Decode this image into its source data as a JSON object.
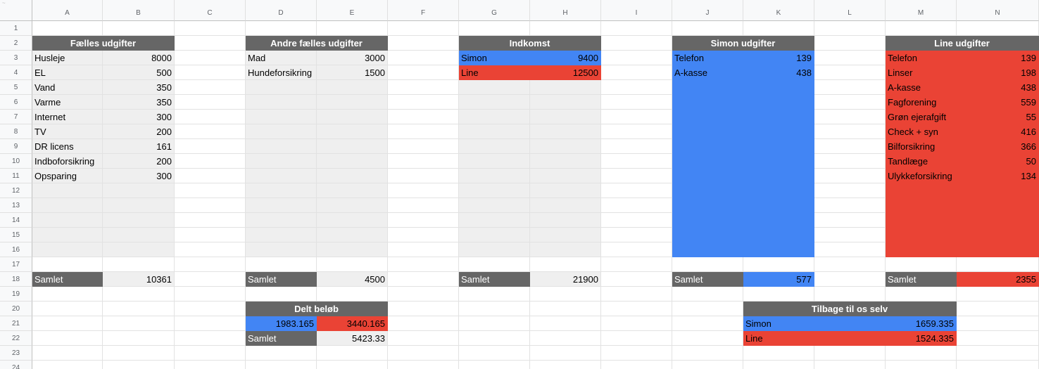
{
  "columns": [
    "A",
    "B",
    "C",
    "D",
    "E",
    "F",
    "G",
    "H",
    "I",
    "J",
    "K",
    "L",
    "M",
    "N"
  ],
  "rows": [
    "1",
    "2",
    "3",
    "4",
    "5",
    "6",
    "7",
    "8",
    "9",
    "10",
    "11",
    "12",
    "13",
    "14",
    "15",
    "16",
    "17",
    "18",
    "19",
    "20",
    "21",
    "22",
    "23",
    "24"
  ],
  "blocks": {
    "faelles": {
      "header": "Fælles udgifter",
      "items": [
        {
          "label": "Husleje",
          "value": "8000"
        },
        {
          "label": "EL",
          "value": "500"
        },
        {
          "label": "Vand",
          "value": "350"
        },
        {
          "label": "Varme",
          "value": "350"
        },
        {
          "label": "Internet",
          "value": "300"
        },
        {
          "label": "TV",
          "value": "200"
        },
        {
          "label": "DR licens",
          "value": "161"
        },
        {
          "label": "Indboforsikring",
          "value": "200"
        },
        {
          "label": "Opsparing",
          "value": "300"
        }
      ],
      "total_label": "Samlet",
      "total": "10361"
    },
    "andre": {
      "header": "Andre fælles udgifter",
      "items": [
        {
          "label": "Mad",
          "value": "3000"
        },
        {
          "label": "Hundeforsikring",
          "value": "1500"
        }
      ],
      "total_label": "Samlet",
      "total": "4500"
    },
    "indkomst": {
      "header": "Indkomst",
      "items": [
        {
          "label": "Simon",
          "value": "9400"
        },
        {
          "label": "Line",
          "value": "12500"
        }
      ],
      "total_label": "Samlet",
      "total": "21900"
    },
    "simon": {
      "header": "Simon udgifter",
      "items": [
        {
          "label": "Telefon",
          "value": "139"
        },
        {
          "label": "A-kasse",
          "value": "438"
        }
      ],
      "total_label": "Samlet",
      "total": "577"
    },
    "line": {
      "header": "Line udgifter",
      "items": [
        {
          "label": "Telefon",
          "value": "139"
        },
        {
          "label": "Linser",
          "value": "198"
        },
        {
          "label": "A-kasse",
          "value": "438"
        },
        {
          "label": "Fagforening",
          "value": "559"
        },
        {
          "label": "Grøn ejerafgift",
          "value": "55"
        },
        {
          "label": "Check + syn",
          "value": "416"
        },
        {
          "label": "Bilforsikring",
          "value": "366"
        },
        {
          "label": "Tandlæge",
          "value": "50"
        },
        {
          "label": "Ulykkeforsikring",
          "value": "134"
        }
      ],
      "total_label": "Samlet",
      "total": "2355"
    },
    "delt": {
      "header": "Delt beløb",
      "simon_value": "1983.165",
      "line_value": "3440.165",
      "total_label": "Samlet",
      "total": "5423.33"
    },
    "tilbage": {
      "header": "Tilbage til os selv",
      "items": [
        {
          "label": "Simon",
          "value": "1659.335"
        },
        {
          "label": "Line",
          "value": "1524.335"
        }
      ]
    }
  },
  "colors": {
    "header_dark": "#666666",
    "gray_fill": "#efefef",
    "simon_blue": "#4285f4",
    "line_red": "#ea4335"
  }
}
